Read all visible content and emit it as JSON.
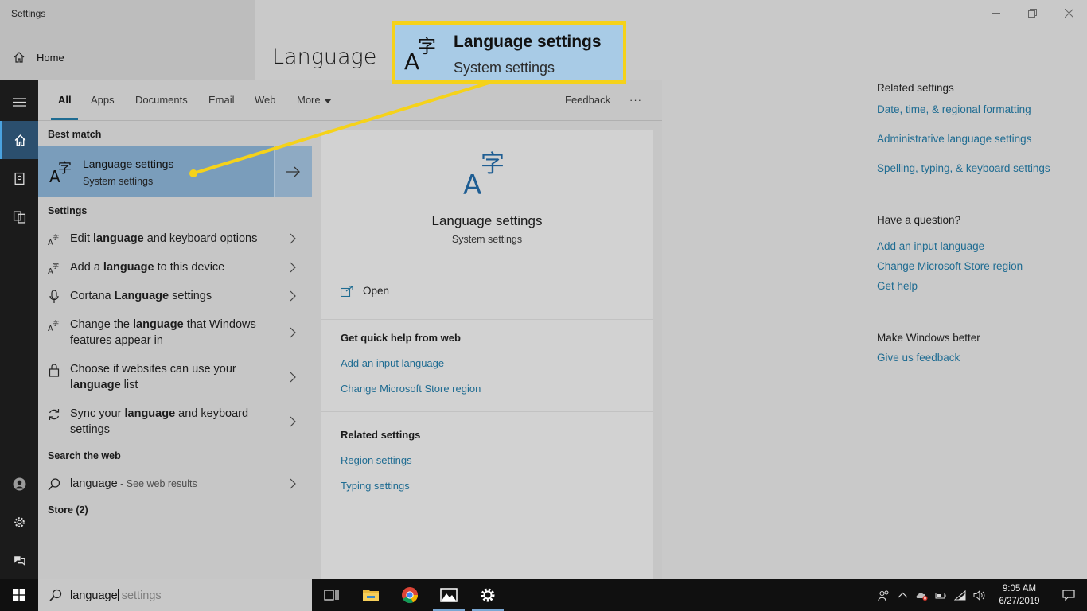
{
  "settings": {
    "window_title": "Settings",
    "home_label": "Home",
    "page_title": "Language",
    "related": {
      "header": "Related settings",
      "links": [
        "Date, time, & regional formatting",
        "Administrative language settings",
        "Spelling, typing, & keyboard settings"
      ]
    },
    "question": {
      "header": "Have a question?",
      "links": [
        "Add an input language",
        "Change Microsoft Store region",
        "Get help"
      ]
    },
    "better": {
      "header": "Make Windows better",
      "link": "Give us feedback"
    }
  },
  "search": {
    "tabs": [
      "All",
      "Apps",
      "Documents",
      "Email",
      "Web",
      "More"
    ],
    "feedback": "Feedback",
    "more_dots": "···",
    "best_match_header": "Best match",
    "best_match": {
      "title": "Language settings",
      "subtitle": "System settings"
    },
    "settings_header": "Settings",
    "settings_items": [
      {
        "pre": "Edit ",
        "bold": "language",
        "post": " and keyboard options"
      },
      {
        "pre": "Add a ",
        "bold": "language",
        "post": " to this device"
      },
      {
        "pre": "Cortana ",
        "bold": "Language",
        "post": " settings"
      },
      {
        "pre": "Change the ",
        "bold": "language",
        "post": " that Windows features appear in"
      },
      {
        "pre": "Choose if websites can use your ",
        "bold": "language",
        "post": " list"
      },
      {
        "pre": "Sync your ",
        "bold": "language",
        "post": " and keyboard settings"
      }
    ],
    "web_header": "Search the web",
    "web_query": "language",
    "web_suffix": " - See web results",
    "store_header": "Store (2)",
    "query_typed": "language",
    "query_suggest": " settings"
  },
  "preview": {
    "title": "Language settings",
    "subtitle": "System settings",
    "open_label": "Open",
    "help_header": "Get quick help from web",
    "help_links": [
      "Add an input language",
      "Change Microsoft Store region"
    ],
    "related_header": "Related settings",
    "related_links": [
      "Region settings",
      "Typing settings"
    ]
  },
  "callout": {
    "title": "Language settings",
    "subtitle": "System settings",
    "border_color": "#f5d21a"
  },
  "taskbar": {
    "time": "9:05 AM",
    "date": "6/27/2019"
  },
  "icons": {
    "language": "language-icon",
    "home": "home-icon",
    "gear": "gear-icon",
    "search": "search-icon"
  },
  "colors": {
    "accent": "#1f6c92",
    "best_match_bg": "#7a9dbb",
    "highlight": "#f5d21a"
  }
}
